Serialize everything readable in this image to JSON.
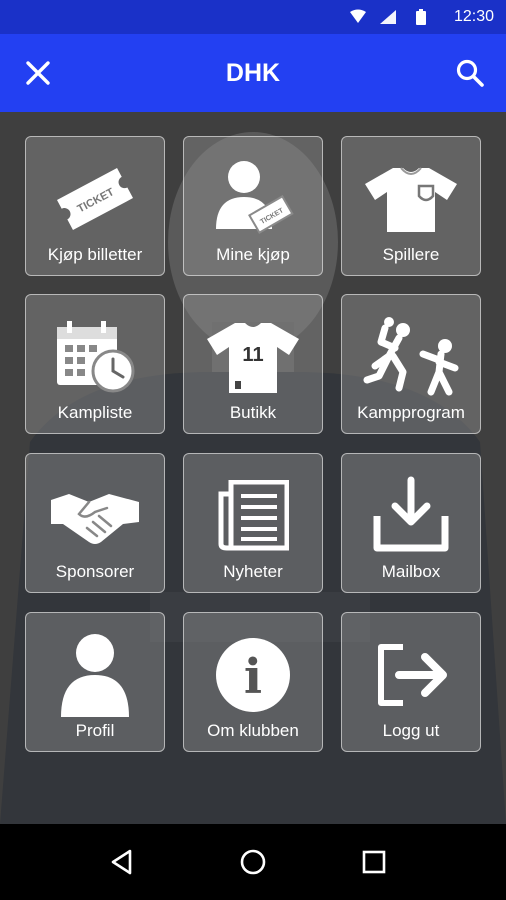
{
  "status_bar": {
    "time": "12:30",
    "icons": [
      "wifi-icon",
      "signal-icon",
      "battery-icon"
    ],
    "color": "#1a31c8"
  },
  "app_bar": {
    "title": "DHK",
    "close_icon": "close-icon",
    "search_icon": "search-icon",
    "color": "#2340f2"
  },
  "menu": {
    "tiles": [
      {
        "label": "Kjøp billetter",
        "icon": "ticket-icon",
        "ticket_text": "TICKET"
      },
      {
        "label": "Mine kjøp",
        "icon": "user-ticket-icon",
        "ticket_text": "TICKET"
      },
      {
        "label": "Spillere",
        "icon": "jersey-icon"
      },
      {
        "label": "Kampliste",
        "icon": "calendar-clock-icon"
      },
      {
        "label": "Butikk",
        "icon": "shirt-11-icon",
        "shirt_number": "11"
      },
      {
        "label": "Kampprogram",
        "icon": "handball-players-icon"
      },
      {
        "label": "Sponsorer",
        "icon": "handshake-icon"
      },
      {
        "label": "Nyheter",
        "icon": "newspaper-icon"
      },
      {
        "label": "Mailbox",
        "icon": "inbox-download-icon"
      },
      {
        "label": "Profil",
        "icon": "person-icon"
      },
      {
        "label": "Om klubben",
        "icon": "info-icon",
        "info_glyph": "i"
      },
      {
        "label": "Logg ut",
        "icon": "logout-icon"
      }
    ]
  },
  "nav_bar": {
    "buttons": [
      "back-icon",
      "home-icon",
      "recents-icon"
    ]
  }
}
